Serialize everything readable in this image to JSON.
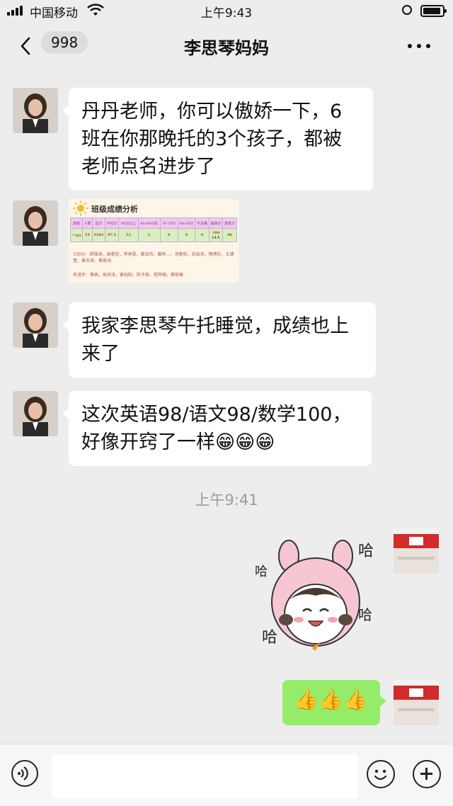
{
  "status": {
    "carrier": "中国移动",
    "time": "上午9:43"
  },
  "nav": {
    "back_count": "998",
    "title": "李思琴妈妈"
  },
  "messages": [
    {
      "text": "丹丹老师，你可以傲娇一下，6班在你那晚托的3个孩子，都被老师点名进步了"
    },
    {
      "image": {
        "title": "班级成绩分析",
        "headers": [
          "班级",
          "人数",
          "总分",
          "平均分",
          "90分以上",
          "80-90分段",
          "70-79分",
          "60-69分",
          "不及格",
          "最高分",
          "最低分"
        ],
        "row": [
          "一(6)",
          "54",
          "5263",
          "97.5",
          "52",
          "2",
          "0",
          "0",
          "0",
          "100",
          "86"
        ],
        "row_note": "11人",
        "line1": "100分：郝锦涛，谢睿欣，李承恩，黄钰伟，黄梓…，汤紫欣，苏绍尧，陶博乐，王靖萱，黄天琦，蔡景润",
        "line2": "有进步：蔡君，侯尚泽，黄灿阳，陈子辰，程梓钢，蔡熙琳"
      }
    },
    {
      "text": "我家李思琴午托睡觉，成绩也上来了"
    },
    {
      "text": "这次英语98/语文98/数学100，好像开窍了一样😁😁😁"
    }
  ],
  "timestamp": "上午9:41",
  "sticker": {
    "text": "哈"
  },
  "reply": {
    "text": "👍👍👍"
  },
  "input": {
    "placeholder": ""
  },
  "colors": {
    "bubble_right": "#95ec69",
    "background": "#ededed",
    "timestamp": "#9a9a9a"
  }
}
